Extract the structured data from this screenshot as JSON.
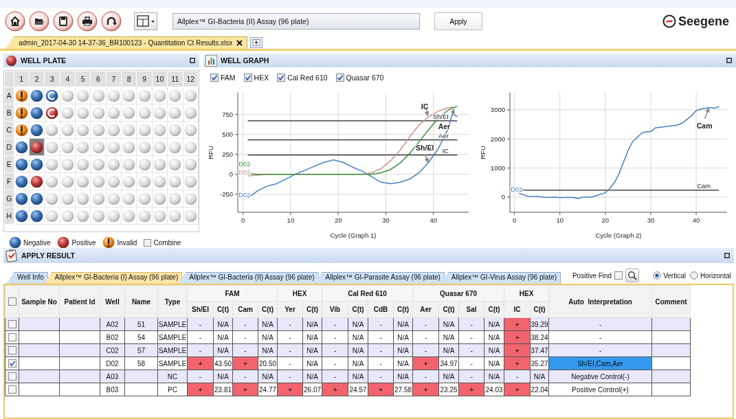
{
  "toolbar": {
    "assay": {
      "value": "Allplex™ GI-Bacteria (II) Assay (96 plate)"
    },
    "apply": "Apply",
    "logo": "Seegene"
  },
  "file_tabs": [
    {
      "label": "admin_2017-04-30 14-37-36_BR100123 -  Quantitation Ct Results.xlsx",
      "selected": true
    }
  ],
  "well_plate": {
    "title": "WELL PLATE",
    "columns": [
      "1",
      "2",
      "3",
      "4",
      "5",
      "6",
      "7",
      "8",
      "9",
      "10",
      "11",
      "12"
    ],
    "rows": [
      {
        "label": "A",
        "wells": [
          {
            "kind": "invalid",
            "selected": false
          },
          {
            "kind": "negative",
            "selected": false
          },
          {
            "kind": "control_negative",
            "selected": false
          },
          {
            "kind": "empty",
            "selected": false
          },
          {
            "kind": "empty",
            "selected": false
          },
          {
            "kind": "empty",
            "selected": false
          },
          {
            "kind": "empty",
            "selected": false
          },
          {
            "kind": "empty",
            "selected": false
          },
          {
            "kind": "empty",
            "selected": false
          },
          {
            "kind": "empty",
            "selected": false
          },
          {
            "kind": "empty",
            "selected": false
          },
          {
            "kind": "empty",
            "selected": false
          }
        ]
      },
      {
        "label": "B",
        "wells": [
          {
            "kind": "invalid",
            "selected": false
          },
          {
            "kind": "negative",
            "selected": false
          },
          {
            "kind": "control_positive",
            "selected": false
          },
          {
            "kind": "empty",
            "selected": false
          },
          {
            "kind": "empty",
            "selected": false
          },
          {
            "kind": "empty",
            "selected": false
          },
          {
            "kind": "empty",
            "selected": false
          },
          {
            "kind": "empty",
            "selected": false
          },
          {
            "kind": "empty",
            "selected": false
          },
          {
            "kind": "empty",
            "selected": false
          },
          {
            "kind": "empty",
            "selected": false
          },
          {
            "kind": "empty",
            "selected": false
          }
        ]
      },
      {
        "label": "C",
        "wells": [
          {
            "kind": "invalid",
            "selected": false
          },
          {
            "kind": "negative",
            "selected": false
          },
          {
            "kind": "empty",
            "selected": false
          },
          {
            "kind": "empty",
            "selected": false
          },
          {
            "kind": "empty",
            "selected": false
          },
          {
            "kind": "empty",
            "selected": false
          },
          {
            "kind": "empty",
            "selected": false
          },
          {
            "kind": "empty",
            "selected": false
          },
          {
            "kind": "empty",
            "selected": false
          },
          {
            "kind": "empty",
            "selected": false
          },
          {
            "kind": "empty",
            "selected": false
          },
          {
            "kind": "empty",
            "selected": false
          }
        ]
      },
      {
        "label": "D",
        "wells": [
          {
            "kind": "negative",
            "selected": false
          },
          {
            "kind": "positive",
            "selected": true
          },
          {
            "kind": "empty",
            "selected": false
          },
          {
            "kind": "empty",
            "selected": false
          },
          {
            "kind": "empty",
            "selected": false
          },
          {
            "kind": "empty",
            "selected": false
          },
          {
            "kind": "empty",
            "selected": false
          },
          {
            "kind": "empty",
            "selected": false
          },
          {
            "kind": "empty",
            "selected": false
          },
          {
            "kind": "empty",
            "selected": false
          },
          {
            "kind": "empty",
            "selected": false
          },
          {
            "kind": "empty",
            "selected": false
          }
        ]
      },
      {
        "label": "E",
        "wells": [
          {
            "kind": "negative",
            "selected": false
          },
          {
            "kind": "negative",
            "selected": false
          },
          {
            "kind": "empty",
            "selected": false
          },
          {
            "kind": "empty",
            "selected": false
          },
          {
            "kind": "empty",
            "selected": false
          },
          {
            "kind": "empty",
            "selected": false
          },
          {
            "kind": "empty",
            "selected": false
          },
          {
            "kind": "empty",
            "selected": false
          },
          {
            "kind": "empty",
            "selected": false
          },
          {
            "kind": "empty",
            "selected": false
          },
          {
            "kind": "empty",
            "selected": false
          },
          {
            "kind": "empty",
            "selected": false
          }
        ]
      },
      {
        "label": "F",
        "wells": [
          {
            "kind": "negative",
            "selected": false
          },
          {
            "kind": "positive",
            "selected": false
          },
          {
            "kind": "empty",
            "selected": false
          },
          {
            "kind": "empty",
            "selected": false
          },
          {
            "kind": "empty",
            "selected": false
          },
          {
            "kind": "empty",
            "selected": false
          },
          {
            "kind": "empty",
            "selected": false
          },
          {
            "kind": "empty",
            "selected": false
          },
          {
            "kind": "empty",
            "selected": false
          },
          {
            "kind": "empty",
            "selected": false
          },
          {
            "kind": "empty",
            "selected": false
          },
          {
            "kind": "empty",
            "selected": false
          }
        ]
      },
      {
        "label": "G",
        "wells": [
          {
            "kind": "negative",
            "selected": false
          },
          {
            "kind": "negative",
            "selected": false
          },
          {
            "kind": "empty",
            "selected": false
          },
          {
            "kind": "empty",
            "selected": false
          },
          {
            "kind": "empty",
            "selected": false
          },
          {
            "kind": "empty",
            "selected": false
          },
          {
            "kind": "empty",
            "selected": false
          },
          {
            "kind": "empty",
            "selected": false
          },
          {
            "kind": "empty",
            "selected": false
          },
          {
            "kind": "empty",
            "selected": false
          },
          {
            "kind": "empty",
            "selected": false
          },
          {
            "kind": "empty",
            "selected": false
          }
        ]
      },
      {
        "label": "H",
        "wells": [
          {
            "kind": "negative",
            "selected": false
          },
          {
            "kind": "negative",
            "selected": false
          },
          {
            "kind": "empty",
            "selected": false
          },
          {
            "kind": "empty",
            "selected": false
          },
          {
            "kind": "empty",
            "selected": false
          },
          {
            "kind": "empty",
            "selected": false
          },
          {
            "kind": "empty",
            "selected": false
          },
          {
            "kind": "empty",
            "selected": false
          },
          {
            "kind": "empty",
            "selected": false
          },
          {
            "kind": "empty",
            "selected": false
          },
          {
            "kind": "empty",
            "selected": false
          },
          {
            "kind": "empty",
            "selected": false
          }
        ]
      }
    ],
    "legend": [
      {
        "kind": "negative",
        "label": "Negative"
      },
      {
        "kind": "positive",
        "label": "Positive"
      },
      {
        "kind": "invalid",
        "label": "Invalid"
      }
    ],
    "combine": {
      "label": "Combine",
      "checked": false
    }
  },
  "well_graph": {
    "title": "WELL GRAPH",
    "channels": [
      {
        "label": "FAM",
        "checked": true
      },
      {
        "label": "HEX",
        "checked": true
      },
      {
        "label": "Cal Red 610",
        "checked": true
      },
      {
        "label": "Quasar 670",
        "checked": true
      }
    ],
    "graphs": [
      {
        "chart_data": {
          "type": "line",
          "grid": true,
          "xlabel": "Cycle (Graph 1)",
          "ylabel": "RFU",
          "xlim": [
            -1.1,
            47.4
          ],
          "ylim": [
            -476,
            1022
          ],
          "xticks": [
            0,
            10,
            20,
            30,
            40
          ],
          "yticks": [
            -250,
            0,
            250,
            500,
            750
          ],
          "x": [
            1,
            3,
            5,
            7,
            9,
            11,
            13,
            15,
            17,
            19,
            21,
            23,
            25,
            27,
            29,
            31,
            33,
            35,
            37,
            39,
            41,
            43,
            44,
            45
          ],
          "series": [
            {
              "name": "D02",
              "color": "#4a7fc1",
              "values": [
                -300,
                -210,
                -150,
                -120,
                -60,
                0,
                50,
                100,
                150,
                180,
                150,
                90,
                40,
                -30,
                -100,
                -120,
                -100,
                -60,
                20,
                150,
                320,
                560,
                760,
                720
              ]
            },
            {
              "name": "D02",
              "color": "#c4918a",
              "values": [
                -20,
                -10,
                0,
                0,
                0,
                0,
                0,
                0,
                0,
                0,
                0,
                0,
                0,
                20,
                70,
                170,
                300,
                470,
                620,
                720,
                790,
                830,
                840,
                null
              ]
            },
            {
              "name": "D02",
              "color": "#3f8f3f",
              "values": [
                10,
                0,
                0,
                0,
                0,
                0,
                0,
                0,
                0,
                0,
                0,
                0,
                0,
                0,
                20,
                60,
                140,
                260,
                410,
                560,
                700,
                800,
                830,
                850
              ]
            }
          ],
          "ref_lines": [
            {
              "axis": "y",
              "value": 670,
              "label": "Sh/EI"
            },
            {
              "axis": "y",
              "value": 431,
              "label": "Aer"
            },
            {
              "axis": "y",
              "value": 241,
              "label": "IC"
            }
          ],
          "annotations": [
            "IC",
            "Aer",
            "Sh/EI"
          ]
        }
      },
      {
        "chart_data": {
          "type": "line",
          "grid": true,
          "xlabel": "Cycle (Graph 2)",
          "ylabel": "RFU",
          "xlim": [
            -1,
            46.8
          ],
          "ylim": [
            -520,
            3590
          ],
          "xticks": [
            0,
            10,
            20,
            30,
            40
          ],
          "yticks": [
            0,
            1000,
            2000,
            3000
          ],
          "x": [
            1,
            3,
            5,
            7,
            9,
            10,
            11,
            13,
            14,
            15,
            17,
            19,
            20,
            21,
            22,
            23,
            24,
            25,
            26,
            28,
            29,
            30,
            31,
            33,
            36,
            37,
            39,
            40,
            41,
            43,
            44,
            45
          ],
          "series": [
            {
              "name": "D02",
              "color": "#4a7fc1",
              "values": [
                130,
                30,
                20,
                -10,
                0,
                -20,
                -10,
                -10,
                -50,
                0,
                0,
                100,
                150,
                300,
                500,
                800,
                1200,
                1600,
                1900,
                2200,
                2250,
                2250,
                2380,
                2420,
                2480,
                2550,
                2800,
                2970,
                3030,
                3080,
                3060,
                3110
              ]
            }
          ],
          "ref_lines": [
            {
              "axis": "y",
              "value": 238,
              "label": "Cam"
            }
          ],
          "annotations": [
            "Cam"
          ]
        }
      }
    ]
  },
  "apply_result": {
    "title": "APPLY RESULT",
    "tabs": [
      {
        "label": "Well Info",
        "selected": false
      },
      {
        "label": "Allplex™ GI-Bacteria (I) Assay (96 plate)",
        "selected": true
      },
      {
        "label": "Allplex™ GI-Bacteria (II) Assay (96 plate)",
        "selected": false
      },
      {
        "label": "Allplex™ GI-Parasite Assay (96 plate)",
        "selected": false
      },
      {
        "label": "Allplex™ GI-Virus Assay (96 plate)",
        "selected": false
      }
    ],
    "positive_find": {
      "label": "Positive Find",
      "checked": false
    },
    "orientation": [
      {
        "label": "Vertical",
        "selected": true
      },
      {
        "label": "Horizontal",
        "selected": false
      }
    ],
    "table": {
      "header_checked": false,
      "columns": [
        "Sample No",
        "Patient Id",
        "Well",
        "Name",
        "Type"
      ],
      "groups": [
        {
          "label": "FAM",
          "targets": [
            {
              "name": "Sh/EI",
              "ct_label": "C(t)"
            },
            {
              "name": "Cam",
              "ct_label": "C(t)"
            }
          ]
        },
        {
          "label": "HEX",
          "targets": [
            {
              "name": "Yer",
              "ct_label": "C(t)"
            }
          ]
        },
        {
          "label": "Cal Red 610",
          "targets": [
            {
              "name": "Vib",
              "ct_label": "C(t)"
            },
            {
              "name": "CdB",
              "ct_label": "C(t)"
            }
          ]
        },
        {
          "label": "Quasar 670",
          "targets": [
            {
              "name": "Aer",
              "ct_label": "C(t)"
            },
            {
              "name": "Sal",
              "ct_label": "C(t)"
            }
          ]
        },
        {
          "label": "HEX",
          "targets": [
            {
              "name": "IC",
              "ct_label": "C(t)"
            }
          ]
        }
      ],
      "interpretation_label": "Auto  Interpretation",
      "comment_label": "Comment",
      "rows": [
        {
          "checked": false,
          "well": "A02",
          "name": "51",
          "type": "SAMPLE",
          "results": [
            {
              "call": "-",
              "positive": false,
              "ct": "N/A"
            },
            {
              "call": "-",
              "positive": false,
              "ct": "N/A"
            },
            {
              "call": "-",
              "positive": false,
              "ct": "N/A"
            },
            {
              "call": "-",
              "positive": false,
              "ct": "N/A"
            },
            {
              "call": "-",
              "positive": false,
              "ct": "N/A"
            },
            {
              "call": "-",
              "positive": false,
              "ct": "N/A"
            },
            {
              "call": "-",
              "positive": false,
              "ct": "N/A"
            },
            {
              "call": "+",
              "positive": true,
              "ct": "39.29"
            }
          ],
          "interpretation": "-",
          "interpretation_selected": false
        },
        {
          "checked": false,
          "well": "B02",
          "name": "54",
          "type": "SAMPLE",
          "results": [
            {
              "call": "-",
              "positive": false,
              "ct": "N/A"
            },
            {
              "call": "-",
              "positive": false,
              "ct": "N/A"
            },
            {
              "call": "-",
              "positive": false,
              "ct": "N/A"
            },
            {
              "call": "-",
              "positive": false,
              "ct": "N/A"
            },
            {
              "call": "-",
              "positive": false,
              "ct": "N/A"
            },
            {
              "call": "-",
              "positive": false,
              "ct": "N/A"
            },
            {
              "call": "-",
              "positive": false,
              "ct": "N/A"
            },
            {
              "call": "+",
              "positive": true,
              "ct": "38.24"
            }
          ],
          "interpretation": "-",
          "interpretation_selected": false
        },
        {
          "checked": false,
          "well": "C02",
          "name": "57",
          "type": "SAMPLE",
          "results": [
            {
              "call": "-",
              "positive": false,
              "ct": "N/A"
            },
            {
              "call": "-",
              "positive": false,
              "ct": "N/A"
            },
            {
              "call": "-",
              "positive": false,
              "ct": "N/A"
            },
            {
              "call": "-",
              "positive": false,
              "ct": "N/A"
            },
            {
              "call": "-",
              "positive": false,
              "ct": "N/A"
            },
            {
              "call": "-",
              "positive": false,
              "ct": "N/A"
            },
            {
              "call": "-",
              "positive": false,
              "ct": "N/A"
            },
            {
              "call": "+",
              "positive": true,
              "ct": "37.47"
            }
          ],
          "interpretation": "-",
          "interpretation_selected": false
        },
        {
          "checked": true,
          "well": "D02",
          "name": "58",
          "type": "SAMPLE",
          "results": [
            {
              "call": "+",
              "positive": true,
              "ct": "43.50"
            },
            {
              "call": "+",
              "positive": true,
              "ct": "20.50"
            },
            {
              "call": "-",
              "positive": false,
              "ct": "N/A"
            },
            {
              "call": "-",
              "positive": false,
              "ct": "N/A"
            },
            {
              "call": "-",
              "positive": false,
              "ct": "N/A"
            },
            {
              "call": "+",
              "positive": true,
              "ct": "34.97"
            },
            {
              "call": "-",
              "positive": false,
              "ct": "N/A"
            },
            {
              "call": "+",
              "positive": true,
              "ct": "35.27"
            }
          ],
          "interpretation": "Sh/EI,Cam,Aer",
          "interpretation_selected": true
        },
        {
          "checked": false,
          "well": "A03",
          "type": "NC",
          "results": [
            {
              "call": "-",
              "positive": false,
              "ct": "N/A"
            },
            {
              "call": "-",
              "positive": false,
              "ct": "N/A"
            },
            {
              "call": "-",
              "positive": false,
              "ct": "N/A"
            },
            {
              "call": "-",
              "positive": false,
              "ct": "N/A"
            },
            {
              "call": "-",
              "positive": false,
              "ct": "N/A"
            },
            {
              "call": "-",
              "positive": false,
              "ct": "N/A"
            },
            {
              "call": "-",
              "positive": false,
              "ct": "N/A"
            },
            {
              "call": "-",
              "positive": false,
              "ct": "N/A"
            }
          ],
          "interpretation": "Negative Control(-)",
          "interpretation_selected": false
        },
        {
          "checked": false,
          "well": "B03",
          "type": "PC",
          "results": [
            {
              "call": "+",
              "positive": true,
              "ct": "23.81"
            },
            {
              "call": "+",
              "positive": true,
              "ct": "24.77"
            },
            {
              "call": "+",
              "positive": true,
              "ct": "26.07"
            },
            {
              "call": "+",
              "positive": true,
              "ct": "24.57"
            },
            {
              "call": "+",
              "positive": true,
              "ct": "27.58"
            },
            {
              "call": "+",
              "positive": true,
              "ct": "23.25"
            },
            {
              "call": "+",
              "positive": true,
              "ct": "24.03"
            },
            {
              "call": "+",
              "positive": true,
              "ct": "22.04"
            }
          ],
          "interpretation": "Positive Control(+)",
          "interpretation_selected": false
        }
      ]
    }
  }
}
